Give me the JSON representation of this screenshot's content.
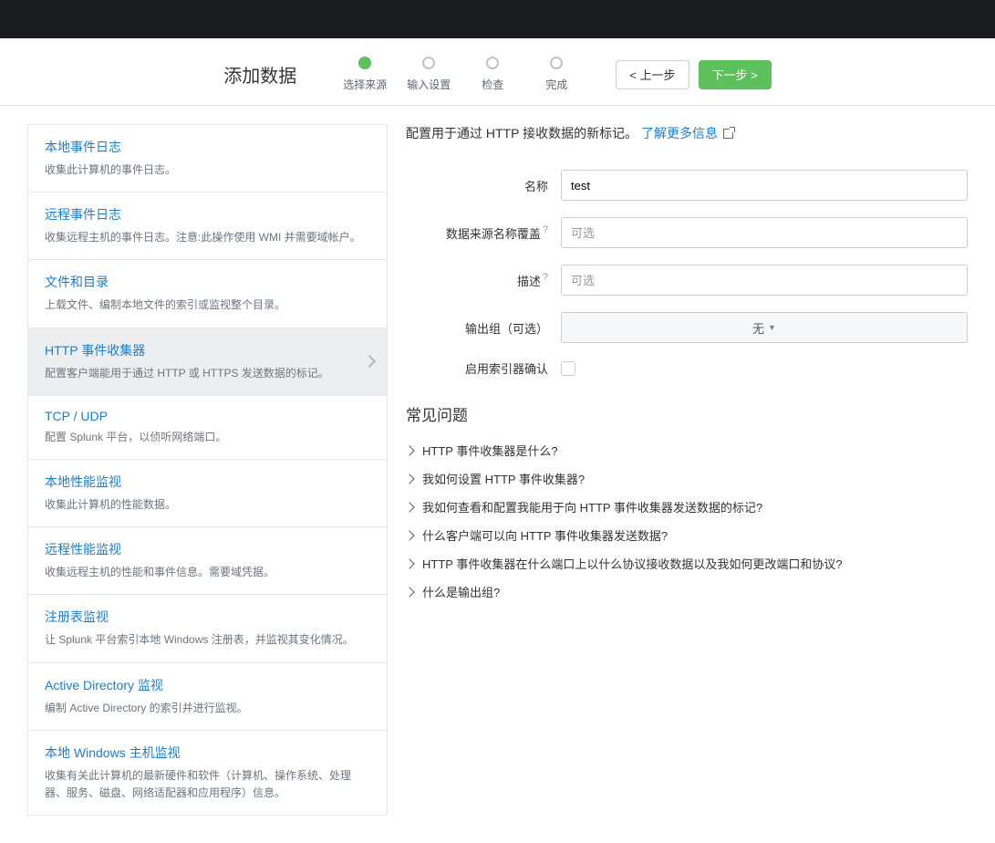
{
  "wizard": {
    "title": "添加数据",
    "steps": [
      "选择来源",
      "输入设置",
      "检查",
      "完成"
    ],
    "activeStep": 0,
    "prevLabel": "< 上一步",
    "nextLabel": "下一步 >"
  },
  "sidebar": {
    "items": [
      {
        "title": "本地事件日志",
        "desc": "收集此计算机的事件日志。"
      },
      {
        "title": "远程事件日志",
        "desc": "收集远程主机的事件日志。注意:此操作使用 WMI 并需要域帐户。"
      },
      {
        "title": "文件和目录",
        "desc": "上载文件、编制本地文件的索引或监视整个目录。"
      },
      {
        "title": "HTTP 事件收集器",
        "desc": "配置客户端能用于通过 HTTP 或 HTTPS 发送数据的标记。",
        "selected": true
      },
      {
        "title": "TCP / UDP",
        "desc": "配置 Splunk 平台，以侦听网络端口。"
      },
      {
        "title": "本地性能监视",
        "desc": "收集此计算机的性能数据。"
      },
      {
        "title": "远程性能监视",
        "desc": "收集远程主机的性能和事件信息。需要域凭据。"
      },
      {
        "title": "注册表监视",
        "desc": "让 Splunk 平台索引本地 Windows 注册表，并监视其变化情况。"
      },
      {
        "title": "Active Directory 监视",
        "desc": "编制 Active Directory 的索引并进行监视。"
      },
      {
        "title": "本地 Windows 主机监视",
        "desc": "收集有关此计算机的最新硬件和软件（计算机、操作系统、处理器、服务、磁盘、网络适配器和应用程序）信息。"
      }
    ]
  },
  "content": {
    "introText": "配置用于通过 HTTP 接收数据的新标记。",
    "learnMore": "了解更多信息",
    "form": {
      "nameLabel": "名称",
      "nameValue": "test",
      "sourceOverrideLabel": "数据来源名称覆盖",
      "sourceOverridePlaceholder": "可选",
      "descLabel": "描述",
      "descPlaceholder": "可选",
      "outputGroupLabel": "输出组（可选）",
      "outputGroupValue": "无",
      "indexerAckLabel": "启用索引器确认"
    },
    "faqTitle": "常见问题",
    "faq": [
      "HTTP 事件收集器是什么?",
      "我如何设置 HTTP 事件收集器?",
      "我如何查看和配置我能用于向 HTTP 事件收集器发送数据的标记?",
      "什么客户端可以向 HTTP 事件收集器发送数据?",
      "HTTP 事件收集器在什么端口上以什么协议接收数据以及我如何更改端口和协议?",
      "什么是输出组?"
    ]
  }
}
